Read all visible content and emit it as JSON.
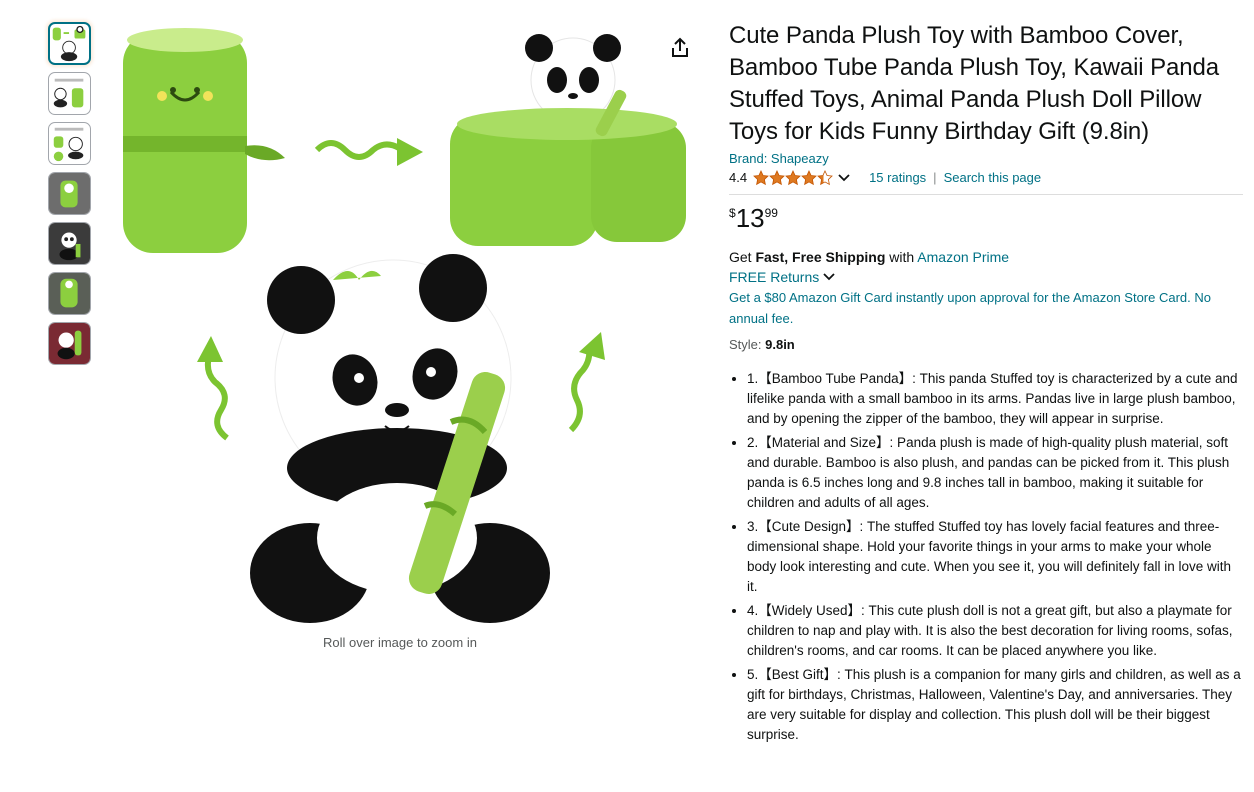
{
  "thumbnails": [
    {
      "name": "bamboo-transform",
      "active": true
    },
    {
      "name": "product-size"
    },
    {
      "name": "product-details"
    },
    {
      "name": "panda-in-bamboo"
    },
    {
      "name": "panda-dark"
    },
    {
      "name": "bamboo-closeup"
    },
    {
      "name": "lifestyle"
    }
  ],
  "main_image": {
    "zoom_hint": "Roll over image to zoom in"
  },
  "product": {
    "title": "Cute Panda Plush Toy with Bamboo Cover, Bamboo Tube Panda Plush Toy, Kawaii Panda Stuffed Toys, Animal Panda Plush Doll Pillow Toys for Kids Funny Birthday Gift (9.8in)",
    "brand": "Brand: Shapeazy",
    "rating": "4.4",
    "ratings_count": "15 ratings",
    "search_link": "Search this page",
    "star_fill": 0.88,
    "price": {
      "symbol": "$",
      "whole": "13",
      "fraction": "99"
    },
    "shipping": {
      "prefix": "Get ",
      "bold": "Fast, Free Shipping",
      "middle": " with ",
      "link": "Amazon Prime"
    },
    "returns": "FREE Returns",
    "gift_card": "Get a $80 Amazon Gift Card instantly upon approval for the Amazon Store Card. No annual fee.",
    "style_label": "Style: ",
    "style_value": "9.8in",
    "bullets": [
      "1.【Bamboo Tube Panda】: This panda Stuffed toy is characterized by a cute and lifelike panda with a small bamboo in its arms. Pandas live in large plush bamboo, and by opening the zipper of the bamboo, they will appear in surprise.",
      "2.【Material and Size】: Panda plush is made of high-quality plush material, soft and durable. Bamboo is also plush, and pandas can be picked from it. This plush panda is 6.5 inches long and 9.8 inches tall in bamboo, making it suitable for children and adults of all ages.",
      "3.【Cute Design】: The stuffed Stuffed toy has lovely facial features and three-dimensional shape. Hold your favorite things in your arms to make your whole body look interesting and cute. When you see it, you will definitely fall in love with it.",
      "4.【Widely Used】: This cute plush doll is not a great gift, but also a playmate for children to nap and play with. It is also the best decoration for living rooms, sofas, children's rooms, and car rooms. It can be placed anywhere you like.",
      "5.【Best Gift】: This plush is a companion for many girls and children, as well as a gift for birthdays, Christmas, Halloween, Valentine's Day, and anniversaries. They are very suitable for display and collection. This plush doll will be their biggest surprise."
    ]
  },
  "colors": {
    "link": "#007185",
    "star": "#de7921",
    "bamboo": "#8ccf3f",
    "text": "#0f1111"
  },
  "icons": [
    "share-icon",
    "star-icon",
    "chevron-down-icon"
  ]
}
